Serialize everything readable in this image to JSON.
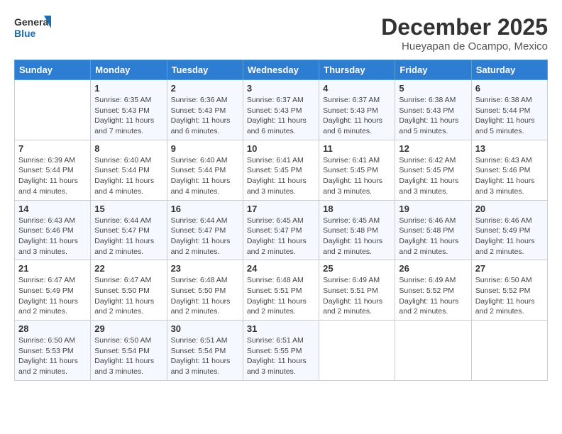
{
  "header": {
    "logo_line1": "General",
    "logo_line2": "Blue",
    "month": "December 2025",
    "location": "Hueyapan de Ocampo, Mexico"
  },
  "weekdays": [
    "Sunday",
    "Monday",
    "Tuesday",
    "Wednesday",
    "Thursday",
    "Friday",
    "Saturday"
  ],
  "weeks": [
    [
      {
        "day": "",
        "info": ""
      },
      {
        "day": "1",
        "info": "Sunrise: 6:35 AM\nSunset: 5:43 PM\nDaylight: 11 hours\nand 7 minutes."
      },
      {
        "day": "2",
        "info": "Sunrise: 6:36 AM\nSunset: 5:43 PM\nDaylight: 11 hours\nand 6 minutes."
      },
      {
        "day": "3",
        "info": "Sunrise: 6:37 AM\nSunset: 5:43 PM\nDaylight: 11 hours\nand 6 minutes."
      },
      {
        "day": "4",
        "info": "Sunrise: 6:37 AM\nSunset: 5:43 PM\nDaylight: 11 hours\nand 6 minutes."
      },
      {
        "day": "5",
        "info": "Sunrise: 6:38 AM\nSunset: 5:43 PM\nDaylight: 11 hours\nand 5 minutes."
      },
      {
        "day": "6",
        "info": "Sunrise: 6:38 AM\nSunset: 5:44 PM\nDaylight: 11 hours\nand 5 minutes."
      }
    ],
    [
      {
        "day": "7",
        "info": "Sunrise: 6:39 AM\nSunset: 5:44 PM\nDaylight: 11 hours\nand 4 minutes."
      },
      {
        "day": "8",
        "info": "Sunrise: 6:40 AM\nSunset: 5:44 PM\nDaylight: 11 hours\nand 4 minutes."
      },
      {
        "day": "9",
        "info": "Sunrise: 6:40 AM\nSunset: 5:44 PM\nDaylight: 11 hours\nand 4 minutes."
      },
      {
        "day": "10",
        "info": "Sunrise: 6:41 AM\nSunset: 5:45 PM\nDaylight: 11 hours\nand 3 minutes."
      },
      {
        "day": "11",
        "info": "Sunrise: 6:41 AM\nSunset: 5:45 PM\nDaylight: 11 hours\nand 3 minutes."
      },
      {
        "day": "12",
        "info": "Sunrise: 6:42 AM\nSunset: 5:45 PM\nDaylight: 11 hours\nand 3 minutes."
      },
      {
        "day": "13",
        "info": "Sunrise: 6:43 AM\nSunset: 5:46 PM\nDaylight: 11 hours\nand 3 minutes."
      }
    ],
    [
      {
        "day": "14",
        "info": "Sunrise: 6:43 AM\nSunset: 5:46 PM\nDaylight: 11 hours\nand 3 minutes."
      },
      {
        "day": "15",
        "info": "Sunrise: 6:44 AM\nSunset: 5:47 PM\nDaylight: 11 hours\nand 2 minutes."
      },
      {
        "day": "16",
        "info": "Sunrise: 6:44 AM\nSunset: 5:47 PM\nDaylight: 11 hours\nand 2 minutes."
      },
      {
        "day": "17",
        "info": "Sunrise: 6:45 AM\nSunset: 5:47 PM\nDaylight: 11 hours\nand 2 minutes."
      },
      {
        "day": "18",
        "info": "Sunrise: 6:45 AM\nSunset: 5:48 PM\nDaylight: 11 hours\nand 2 minutes."
      },
      {
        "day": "19",
        "info": "Sunrise: 6:46 AM\nSunset: 5:48 PM\nDaylight: 11 hours\nand 2 minutes."
      },
      {
        "day": "20",
        "info": "Sunrise: 6:46 AM\nSunset: 5:49 PM\nDaylight: 11 hours\nand 2 minutes."
      }
    ],
    [
      {
        "day": "21",
        "info": "Sunrise: 6:47 AM\nSunset: 5:49 PM\nDaylight: 11 hours\nand 2 minutes."
      },
      {
        "day": "22",
        "info": "Sunrise: 6:47 AM\nSunset: 5:50 PM\nDaylight: 11 hours\nand 2 minutes."
      },
      {
        "day": "23",
        "info": "Sunrise: 6:48 AM\nSunset: 5:50 PM\nDaylight: 11 hours\nand 2 minutes."
      },
      {
        "day": "24",
        "info": "Sunrise: 6:48 AM\nSunset: 5:51 PM\nDaylight: 11 hours\nand 2 minutes."
      },
      {
        "day": "25",
        "info": "Sunrise: 6:49 AM\nSunset: 5:51 PM\nDaylight: 11 hours\nand 2 minutes."
      },
      {
        "day": "26",
        "info": "Sunrise: 6:49 AM\nSunset: 5:52 PM\nDaylight: 11 hours\nand 2 minutes."
      },
      {
        "day": "27",
        "info": "Sunrise: 6:50 AM\nSunset: 5:52 PM\nDaylight: 11 hours\nand 2 minutes."
      }
    ],
    [
      {
        "day": "28",
        "info": "Sunrise: 6:50 AM\nSunset: 5:53 PM\nDaylight: 11 hours\nand 2 minutes."
      },
      {
        "day": "29",
        "info": "Sunrise: 6:50 AM\nSunset: 5:54 PM\nDaylight: 11 hours\nand 3 minutes."
      },
      {
        "day": "30",
        "info": "Sunrise: 6:51 AM\nSunset: 5:54 PM\nDaylight: 11 hours\nand 3 minutes."
      },
      {
        "day": "31",
        "info": "Sunrise: 6:51 AM\nSunset: 5:55 PM\nDaylight: 11 hours\nand 3 minutes."
      },
      {
        "day": "",
        "info": ""
      },
      {
        "day": "",
        "info": ""
      },
      {
        "day": "",
        "info": ""
      }
    ]
  ]
}
